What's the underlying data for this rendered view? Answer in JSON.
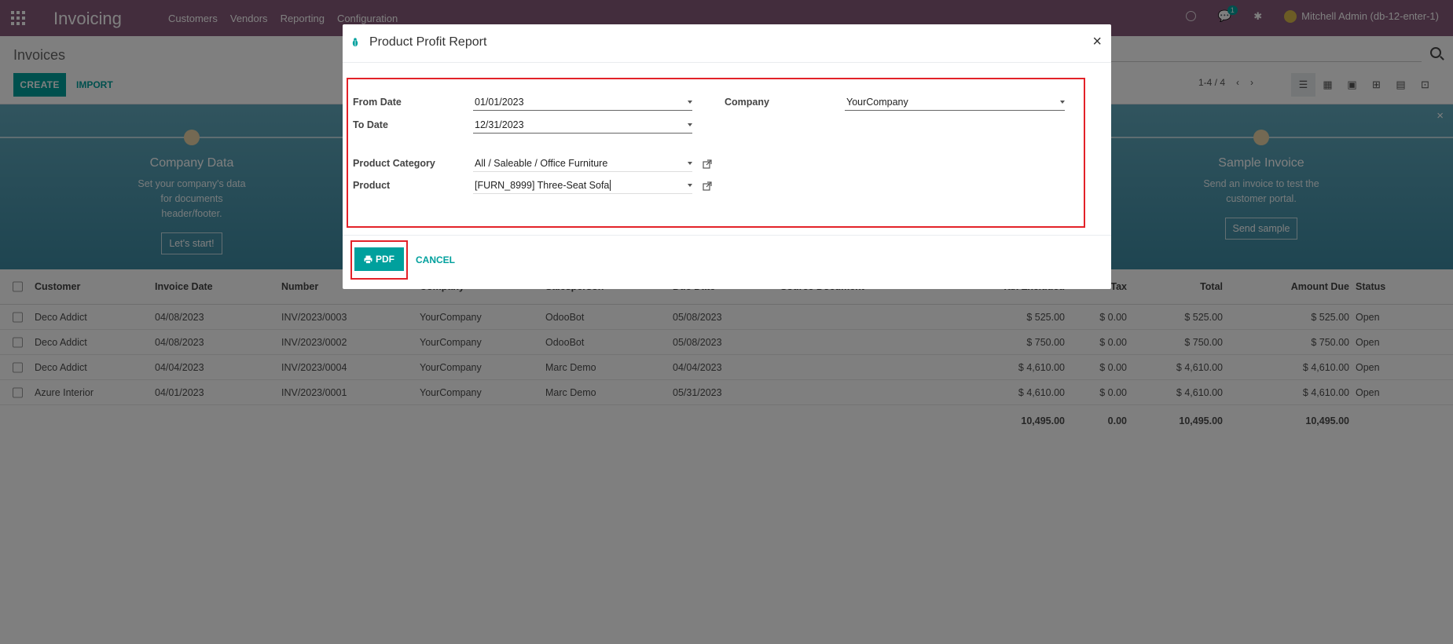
{
  "navbar": {
    "app_title": "Invoicing",
    "menu": [
      "Customers",
      "Vendors",
      "Reporting",
      "Configuration"
    ],
    "chat_badge": "1",
    "user": "Mitchell Admin (db-12-enter-1)"
  },
  "control_panel": {
    "breadcrumb": "Invoices",
    "create_label": "CREATE",
    "import_label": "IMPORT",
    "pager": "1-4 / 4"
  },
  "banner": {
    "steps": [
      {
        "title": "Company Data",
        "desc": "Set your company's data for documents header/footer.",
        "button": "Let's start!"
      },
      {
        "title": "Sample Invoice",
        "desc": "Send an invoice to test the customer portal.",
        "button": "Send sample"
      }
    ]
  },
  "table": {
    "headers": [
      "Customer",
      "Invoice Date",
      "Number",
      "Company",
      "Salesperson",
      "Due Date",
      "Source Document",
      "Tax Excluded",
      "Tax",
      "Total",
      "Amount Due",
      "Status"
    ],
    "rows": [
      [
        "Deco Addict",
        "04/08/2023",
        "INV/2023/0003",
        "YourCompany",
        "OdooBot",
        "05/08/2023",
        "",
        "$ 525.00",
        "$ 0.00",
        "$ 525.00",
        "$ 525.00",
        "Open"
      ],
      [
        "Deco Addict",
        "04/08/2023",
        "INV/2023/0002",
        "YourCompany",
        "OdooBot",
        "05/08/2023",
        "",
        "$ 750.00",
        "$ 0.00",
        "$ 750.00",
        "$ 750.00",
        "Open"
      ],
      [
        "Deco Addict",
        "04/04/2023",
        "INV/2023/0004",
        "YourCompany",
        "Marc Demo",
        "04/04/2023",
        "",
        "$ 4,610.00",
        "$ 0.00",
        "$ 4,610.00",
        "$ 4,610.00",
        "Open"
      ],
      [
        "Azure Interior",
        "04/01/2023",
        "INV/2023/0001",
        "YourCompany",
        "Marc Demo",
        "05/31/2023",
        "",
        "$ 4,610.00",
        "$ 0.00",
        "$ 4,610.00",
        "$ 4,610.00",
        "Open"
      ]
    ],
    "totals": {
      "tax_excluded": "10,495.00",
      "tax": "0.00",
      "total": "10,495.00",
      "amount_due": "10,495.00"
    }
  },
  "modal": {
    "title": "Product Profit Report",
    "close": "×",
    "from_date_label": "From Date",
    "from_date": "01/01/2023",
    "to_date_label": "To Date",
    "to_date": "12/31/2023",
    "company_label": "Company",
    "company": "YourCompany",
    "category_label": "Product Category",
    "category": "All / Saleable / Office Furniture",
    "product_label": "Product",
    "product": "[FURN_8999] Three-Seat Sofa",
    "pdf_label": "PDF",
    "cancel_label": "CANCEL"
  },
  "colors": {
    "brand": "#875a7b",
    "accent": "#00a09d",
    "highlight": "#e32228"
  }
}
